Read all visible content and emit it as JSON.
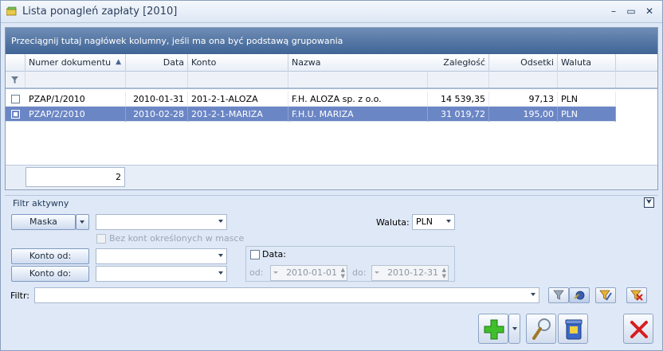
{
  "window": {
    "title": "Lista ponagleń zapłaty [2010]"
  },
  "grid": {
    "group_hint": "Przeciągnij tutaj nagłówek kolumny, jeśli ma ona być podstawą grupowania",
    "columns": {
      "numer": "Numer dokumentu",
      "data": "Data",
      "konto": "Konto",
      "nazwa": "Nazwa",
      "zaleglosc": "Zaległość",
      "odsetki": "Odsetki",
      "waluta": "Waluta"
    },
    "rows": [
      {
        "numer": "PZAP/1/2010",
        "data": "2010-01-31",
        "konto": "201-2-1-ALOZA",
        "nazwa": "F.H. ALOZA sp. z o.o.",
        "zaleglosc": "14 539,35",
        "odsetki": "97,13",
        "waluta": "PLN"
      },
      {
        "numer": "PZAP/2/2010",
        "data": "2010-02-28",
        "konto": "201-2-1-MARIZA",
        "nazwa": "F.H.U. MARIZA",
        "zaleglosc": "31 019,72",
        "odsetki": "195,00",
        "waluta": "PLN"
      }
    ],
    "footer_count": "2"
  },
  "filter": {
    "header": "Filtr aktywny",
    "maska_label": "Maska",
    "maska_value": "",
    "bez_kont_label": "Bez kont określonych w masce",
    "waluta_label": "Waluta:",
    "waluta_value": "PLN",
    "konto_od_label": "Konto od:",
    "konto_od_value": "",
    "konto_do_label": "Konto do:",
    "konto_do_value": "",
    "data_label": "Data:",
    "od_label": "od:",
    "od_value": "2010-01-01",
    "do_label": "do:",
    "do_value": "2010-12-31",
    "filtr_label": "Filtr:",
    "filtr_value": ""
  }
}
